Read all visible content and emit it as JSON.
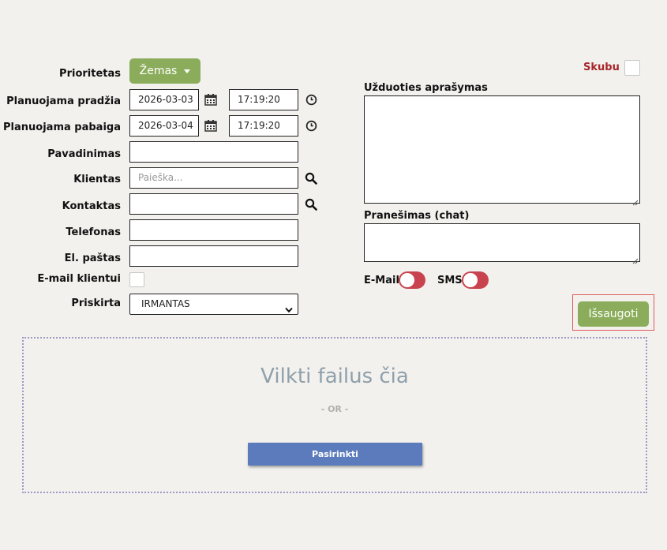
{
  "form": {
    "priority_label": "Prioritetas",
    "priority_value": "Žemas",
    "start_label": "Planuojama pradžia",
    "start_date": "2026-03-03",
    "start_time": "17:19:20",
    "end_label": "Planuojama pabaiga",
    "end_date": "2026-03-04",
    "end_time": "17:19:20",
    "name_label": "Pavadinimas",
    "name_value": "",
    "client_label": "Klientas",
    "client_placeholder": "Paieška...",
    "contact_label": "Kontaktas",
    "contact_value": "",
    "phone_label": "Telefonas",
    "phone_value": "",
    "email_label": "El. paštas",
    "email_value": "",
    "email_client_label": "E-mail klientui",
    "assigned_label": "Priskirta",
    "assigned_value": "IRMANTAS"
  },
  "right": {
    "urgent_label": "Skubu !",
    "task_desc_label": "Užduoties aprašymas",
    "chat_label": "Pranešimas (chat)",
    "email_toggle_label": "E-Mail",
    "sms_toggle_label": "SMS",
    "save_label": "Išsaugoti"
  },
  "dropzone": {
    "title": "Vilkti failus čia",
    "or_text": "- OR -",
    "choose_label": "Pasirinkti"
  },
  "colors": {
    "accent_green": "#8bad5b",
    "urgent_red": "#a8262b",
    "toggle_red": "#c9434e",
    "choose_blue": "#5b7bbd",
    "highlight_border": "#e05a5a"
  }
}
